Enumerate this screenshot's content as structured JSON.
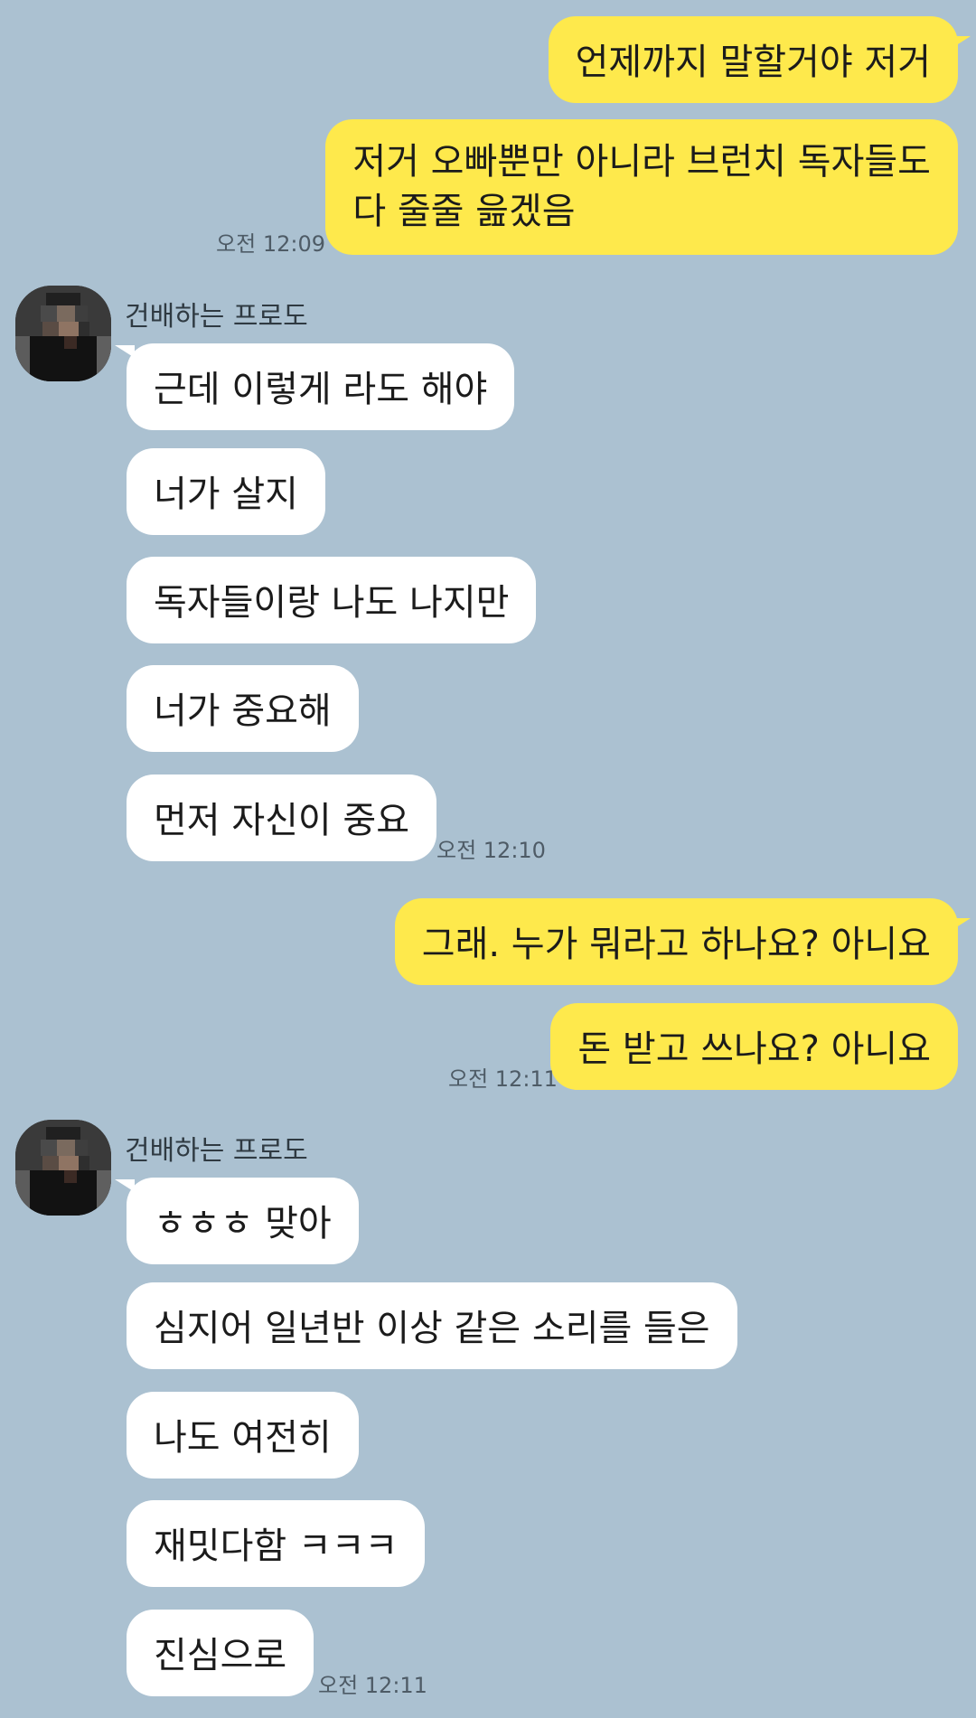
{
  "chat": {
    "outgoing_1": [
      "언제까지 말할거야 저거"
    ],
    "outgoing_2": [
      "저거 오빠뿐만 아니라 브런치 독자들도",
      "다 줄줄 읊겠음"
    ],
    "time_1": "오전 12:09",
    "sender_name_1": "건배하는 프로도",
    "incoming_1": [
      "근데 이렇게 라도 해야",
      "너가 살지",
      "독자들이랑 나도 나지만",
      "너가 중요해",
      "먼저 자신이 중요"
    ],
    "time_2": "오전 12:10",
    "outgoing_3": [
      "그래. 누가 뭐라고 하나요? 아니요",
      "돈 받고 쓰나요? 아니요"
    ],
    "time_3": "오전 12:11",
    "sender_name_2": "건배하는 프로도",
    "incoming_2": [
      "ㅎㅎㅎ 맞아",
      "심지어 일년반 이상 같은 소리를 들은",
      "나도 여전히",
      "재밋다함 ㅋㅋㅋ",
      "진심으로"
    ],
    "time_4": "오전 12:11"
  },
  "avatar_icon": "person-avatar-icon",
  "colors": {
    "background": "#abc1d1",
    "outgoing_bubble": "#fee94c",
    "incoming_bubble": "#ffffff"
  }
}
